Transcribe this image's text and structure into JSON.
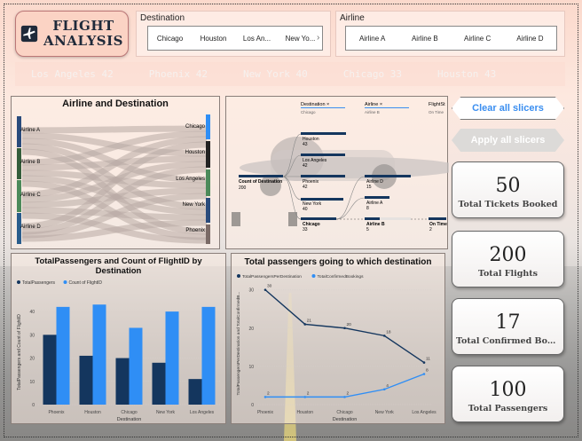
{
  "app": {
    "title_line1": "FLIGHT",
    "title_line2": "ANALYSIS"
  },
  "destination_slicer": {
    "title": "Destination",
    "items": [
      "Chicago",
      "Houston",
      "Los An...",
      "New Yo..."
    ]
  },
  "airline_slicer": {
    "title": "Airline",
    "items": [
      "Airline A",
      "Airline B",
      "Airline C",
      "Airline D"
    ]
  },
  "ticker": [
    "Los Angeles 42",
    "Phoenix 42",
    "New York 40",
    "Chicago 33",
    "Houston 43"
  ],
  "buttons": {
    "clear_all": "Clear all slicers",
    "apply_all": "Apply all slicers"
  },
  "kpis": [
    {
      "value": "50",
      "label": "Total Tickets Booked"
    },
    {
      "value": "200",
      "label": "Total Flights"
    },
    {
      "value": "17",
      "label": "Total Confirmed Book..."
    },
    {
      "value": "100",
      "label": "Total Passengers"
    }
  ],
  "sankey": {
    "title": "Airline and Destination",
    "airlines": [
      "Airline A",
      "Airline B",
      "Airline C",
      "Airline D"
    ],
    "destinations": [
      "Chicago",
      "Houston",
      "Los Angeles",
      "New York",
      "Phoenix"
    ]
  },
  "decomposition": {
    "columns": [
      {
        "header": "Destination",
        "sub": "Chicago"
      },
      {
        "header": "Airline",
        "sub": "Airline B"
      },
      {
        "header": "FlightSt",
        "sub": "On Time"
      }
    ],
    "root": {
      "label": "Count of Destination",
      "value": "200"
    },
    "destinations": [
      {
        "label": "Houston",
        "value": "43"
      },
      {
        "label": "Los Angeles",
        "value": "42"
      },
      {
        "label": "Phoenix",
        "value": "42"
      },
      {
        "label": "New York",
        "value": "40"
      },
      {
        "label": "Chicago",
        "value": "33"
      }
    ],
    "airlines": [
      {
        "label": "Airline D",
        "value": "15"
      },
      {
        "label": "Airline A",
        "value": "8"
      },
      {
        "label": "Airline B",
        "value": "5"
      }
    ],
    "status": {
      "label": "On Time",
      "value": "2"
    }
  },
  "chart_data": [
    {
      "type": "bar",
      "title": "TotalPassengers and Count of FlightID by Destination",
      "xlabel": "Destination",
      "ylabel": "TotalPassengers and Count of FlightID",
      "categories": [
        "Phoenix",
        "Houston",
        "Chicago",
        "New York",
        "Los Angeles"
      ],
      "series": [
        {
          "name": "TotalPassengers",
          "values": [
            30,
            21,
            20,
            18,
            11
          ],
          "color": "#14365e"
        },
        {
          "name": "Count of FlightID",
          "values": [
            42,
            43,
            33,
            40,
            42
          ],
          "color": "#2f8ef5"
        }
      ],
      "yticks": [
        0,
        10,
        20,
        30,
        40
      ],
      "ylim": [
        0,
        45
      ],
      "legend": "top-left"
    },
    {
      "type": "line",
      "title": "Total passengers going to which destination",
      "xlabel": "Destination",
      "ylabel": "TotalPassengersPerDestination and TotalConfirmedB...",
      "categories": [
        "Phoenix",
        "Houston",
        "Chicago",
        "New York",
        "Los Angeles"
      ],
      "series": [
        {
          "name": "TotalPassengersPerDestination",
          "values": [
            30,
            21,
            20,
            18,
            11
          ],
          "color": "#14365e"
        },
        {
          "name": "TotalConfirmedBookings",
          "values": [
            2,
            2,
            2,
            4,
            8
          ],
          "color": "#2f8ef5"
        }
      ],
      "yticks": [
        0,
        10,
        20,
        30
      ],
      "ylim": [
        0,
        32
      ],
      "legend": "top-left"
    }
  ]
}
